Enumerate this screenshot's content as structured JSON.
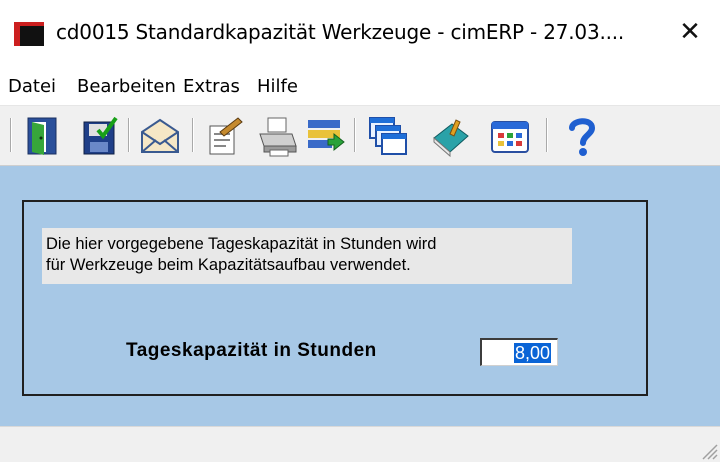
{
  "window": {
    "title": "cd0015 Standardkapazität Werkzeuge - cimERP - 27.03....",
    "close_glyph": "✕"
  },
  "menu": {
    "items": [
      "Datei",
      "Bearbeiten",
      "Extras",
      "Hilfe"
    ]
  },
  "toolbar": {
    "icons": [
      "exit-door-icon",
      "save-icon",
      "mail-icon",
      "edit-document-icon",
      "print-icon",
      "transfer-icon",
      "windows-icon",
      "book-icon",
      "calendar-icon",
      "help-icon"
    ]
  },
  "form": {
    "info_line1": "Die hier vorgegebene Tageskapazität in Stunden wird",
    "info_line2": "für Werkzeuge beim Kapazitätsaufbau verwendet.",
    "field_label": "Tageskapazität in Stunden",
    "field_value": "8,00"
  },
  "colors": {
    "content_bg": "#a7c8e6",
    "selection": "#0a64d6",
    "app_icon_red": "#cc1f1f"
  }
}
